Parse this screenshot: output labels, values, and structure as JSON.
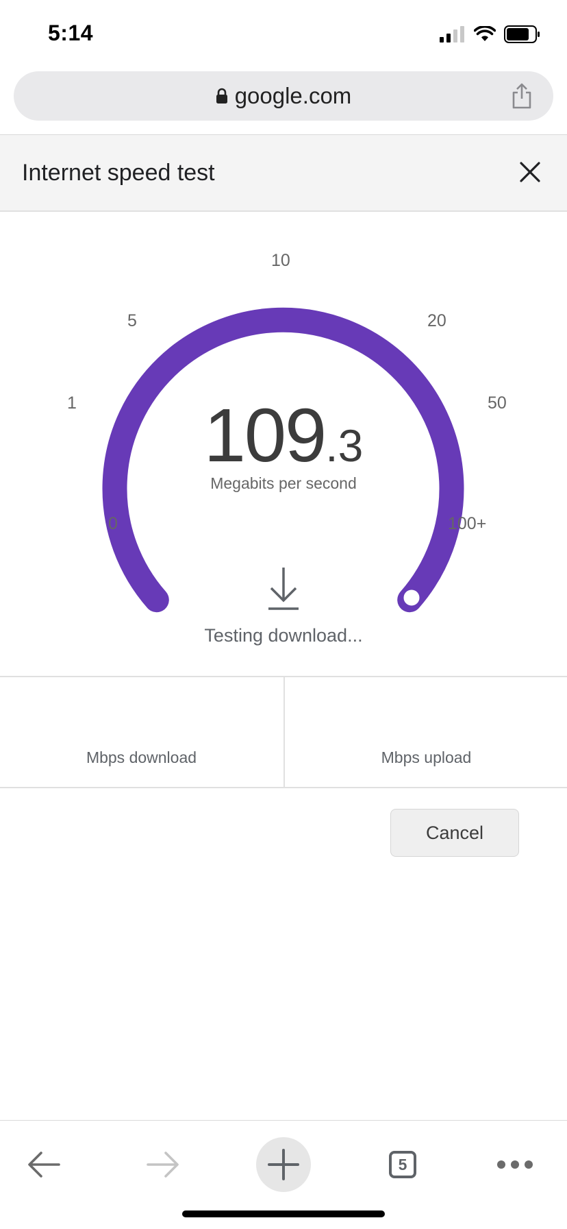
{
  "status_bar": {
    "time": "5:14"
  },
  "url_bar": {
    "domain": "google.com",
    "lock_icon": "lock-icon",
    "share_icon": "share-icon"
  },
  "card": {
    "title": "Internet speed test",
    "close_icon": "close-icon"
  },
  "gauge": {
    "accent_color": "#673ab7",
    "scale_labels": [
      "0",
      "1",
      "5",
      "10",
      "20",
      "50",
      "100+"
    ],
    "speed_integer": "109",
    "speed_decimal": ".3",
    "unit": "Megabits per second",
    "status_text": "Testing download...",
    "status_icon": "download-icon"
  },
  "results": {
    "download_label": "Mbps download",
    "upload_label": "Mbps upload"
  },
  "actions": {
    "cancel_label": "Cancel"
  },
  "toolbar": {
    "open_tabs_count": "5",
    "icons": [
      "back-arrow-icon",
      "forward-arrow-icon",
      "plus-icon",
      "tabs-icon",
      "more-dots-icon"
    ]
  }
}
